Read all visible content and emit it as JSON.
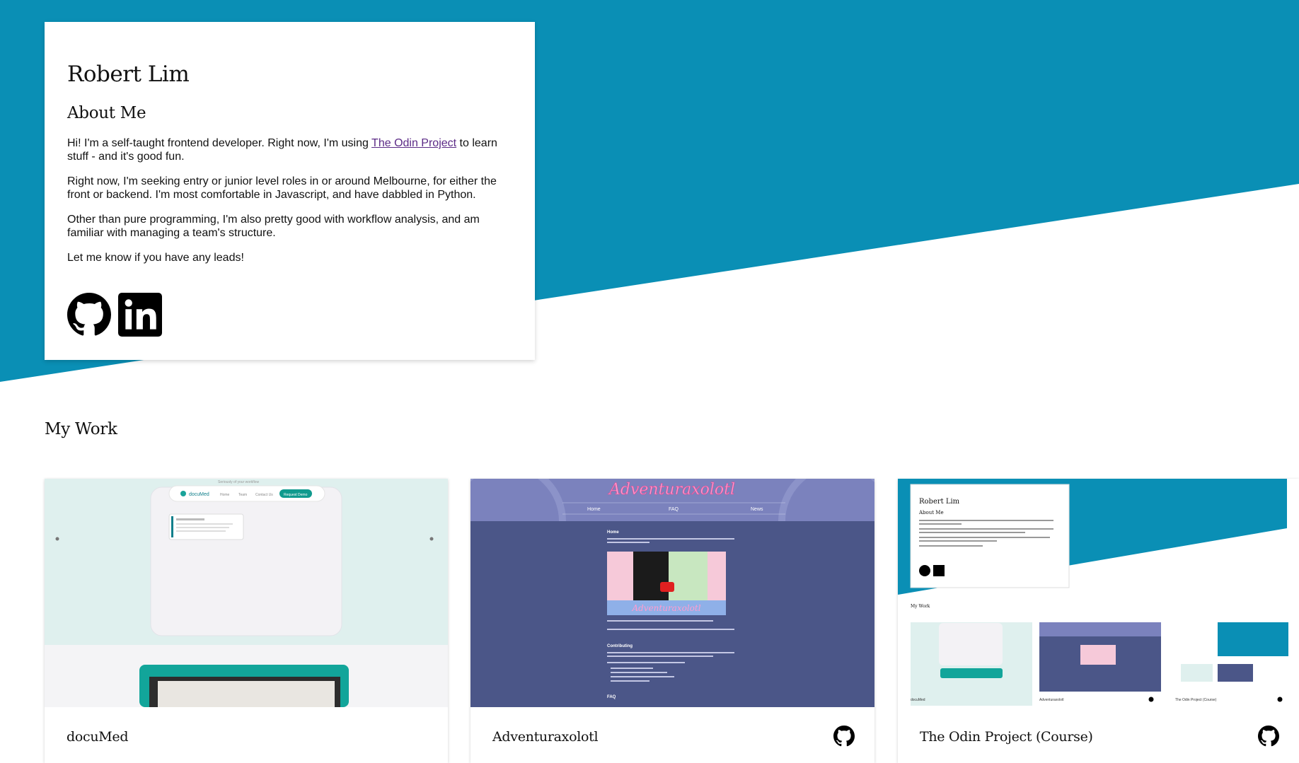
{
  "about": {
    "name": "Robert Lim",
    "heading": "About Me",
    "p1_before": "Hi! I'm a self-taught frontend developer. Right now, I'm using ",
    "p1_link": "The Odin Project",
    "p1_after": " to learn stuff - and it's good fun.",
    "p2": "Right now, I'm seeking entry or junior level roles in or around Melbourne, for either the front or backend. I'm most comfortable in Javascript, and have dabbled in Python.",
    "p3": "Other than pure programming, I'm also pretty good with workflow analysis, and am familiar with managing a team's structure.",
    "p4": "Let me know if you have any leads!",
    "socials": [
      {
        "icon": "github-icon",
        "label": "GitHub"
      },
      {
        "icon": "linkedin-icon",
        "label": "LinkedIn"
      }
    ]
  },
  "work": {
    "title": "My Work",
    "projects": [
      {
        "title": "docuMed",
        "icon": "github-icon"
      },
      {
        "title": "Adventuraxolotl",
        "icon": "github-icon"
      },
      {
        "title": "The Odin Project (Course)",
        "icon": "github-icon"
      }
    ]
  },
  "thumbs": {
    "documed": {
      "logo": "docuMed",
      "nav": [
        "Home",
        "Team",
        "Contact Us"
      ],
      "cta": "Request Demo",
      "tagline": "Seriously of your workflow"
    },
    "adventuraxolotl": {
      "logo": "Adventuraxolotl",
      "nav": [
        "Home",
        "FAQ",
        "News"
      ],
      "section1": "Home",
      "section2": "Contributing",
      "section3": "FAQ"
    },
    "odin": {
      "name": "Robert Lim",
      "heading": "About Me",
      "work": "My Work",
      "items": [
        "docuMed",
        "Adventuraxolotl",
        "The Odin Project (Course)"
      ]
    }
  },
  "colors": {
    "teal": "#0a8fb5",
    "documed_bg": "#dff0ee",
    "adventure_bg": "#4b5688",
    "adventure_header": "#7b82bd",
    "link": "#5b2a86"
  }
}
